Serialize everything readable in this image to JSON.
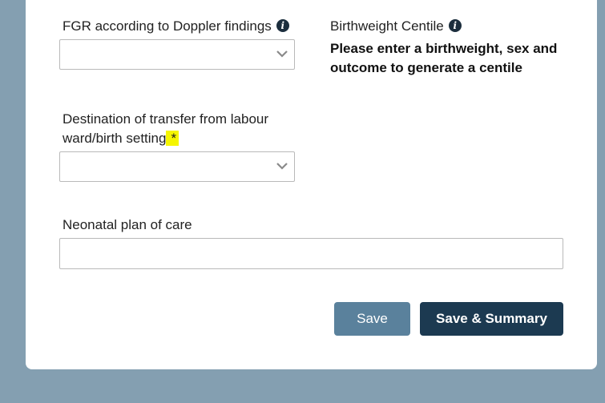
{
  "fields": {
    "fgr": {
      "label": "FGR according to Doppler findings",
      "value": ""
    },
    "centile": {
      "label": "Birthweight Centile",
      "message": "Please enter a birthweight, sex and outcome to generate a centile"
    },
    "destination": {
      "label_line1": "Destination of transfer from labour",
      "label_line2": "ward/birth setting",
      "required_marker": "*",
      "value": ""
    },
    "neonatal_plan": {
      "label": "Neonatal plan of care",
      "value": ""
    }
  },
  "buttons": {
    "save": "Save",
    "save_summary": "Save & Summary"
  },
  "colors": {
    "page_bg": "#849fb1",
    "card_bg": "#ffffff",
    "save_button": "#5a819c",
    "save_summary_button": "#1c3a51",
    "required_highlight": "#f5f500"
  },
  "icons": {
    "info": "info-icon",
    "dropdown": "chevron-down-icon"
  }
}
